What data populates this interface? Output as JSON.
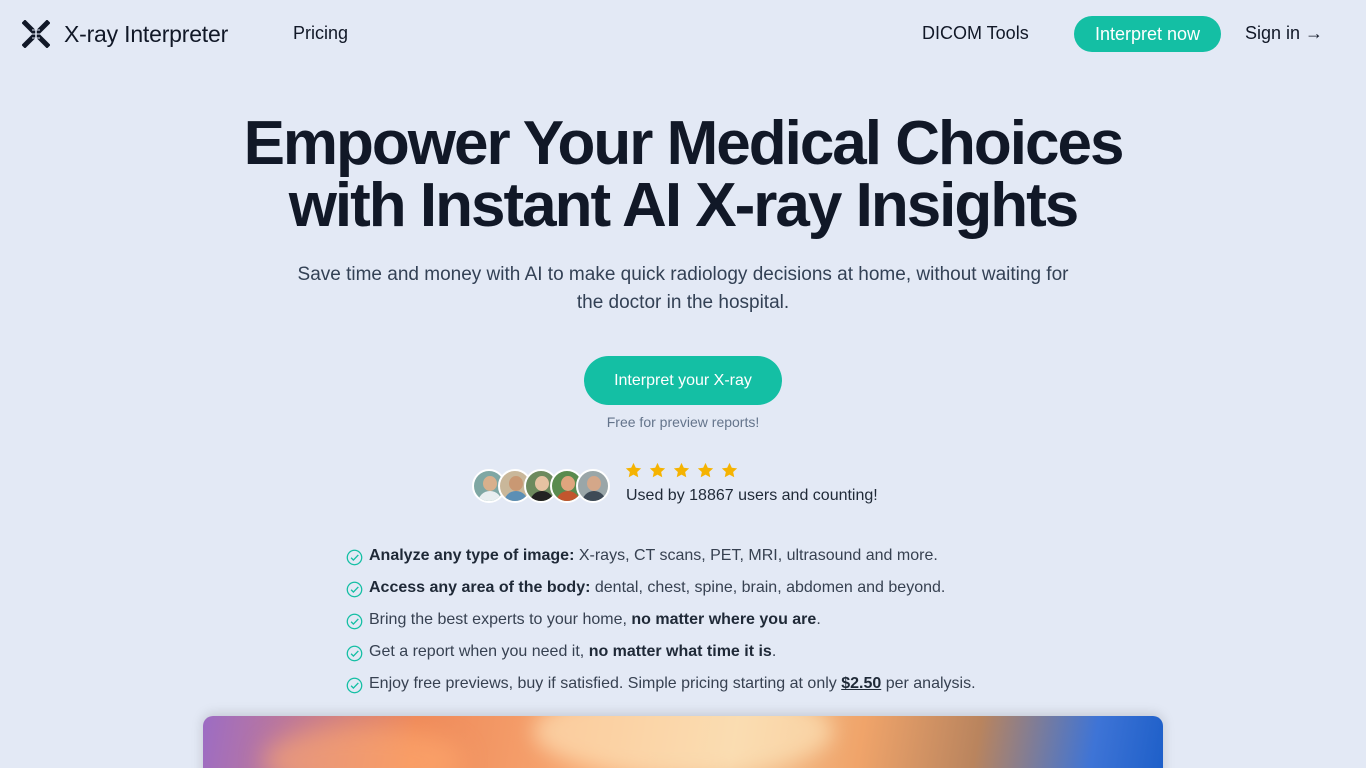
{
  "nav": {
    "brand": "X-ray Interpreter",
    "pricing": "Pricing",
    "dicom_tools": "DICOM Tools",
    "interpret_now": "Interpret now",
    "sign_in": "Sign in",
    "sign_in_arrow": "→"
  },
  "hero": {
    "title_line1": "Empower Your Medical Choices",
    "title_line2": "with Instant AI X-ray Insights",
    "subtitle": "Save time and money with AI to make quick radiology decisions at home, without waiting for the doctor in the hospital.",
    "cta": "Interpret your X-ray",
    "note": "Free for preview reports!"
  },
  "social_proof": {
    "rating_stars": 5,
    "text": "Used by 18867 users and counting!"
  },
  "features": [
    {
      "bold": "Analyze any type of image:",
      "text": " X-rays, CT scans, PET, MRI, ultrasound and more."
    },
    {
      "bold": "Access any area of the body:",
      "text": " dental, chest, spine, brain, abdomen and beyond."
    },
    {
      "pre": "Bring the best experts to your home, ",
      "bold": "no matter where you are",
      "post": "."
    },
    {
      "pre": "Get a report when you need it, ",
      "bold": "no matter what time it is",
      "post": "."
    },
    {
      "pre": "Enjoy free previews, buy if satisfied. Simple pricing starting at only ",
      "price": "$2.50",
      "post": " per analysis."
    }
  ],
  "colors": {
    "background": "#e3e9f5",
    "accent": "#14bfa4",
    "star": "#f5b301",
    "heading": "#111827"
  }
}
